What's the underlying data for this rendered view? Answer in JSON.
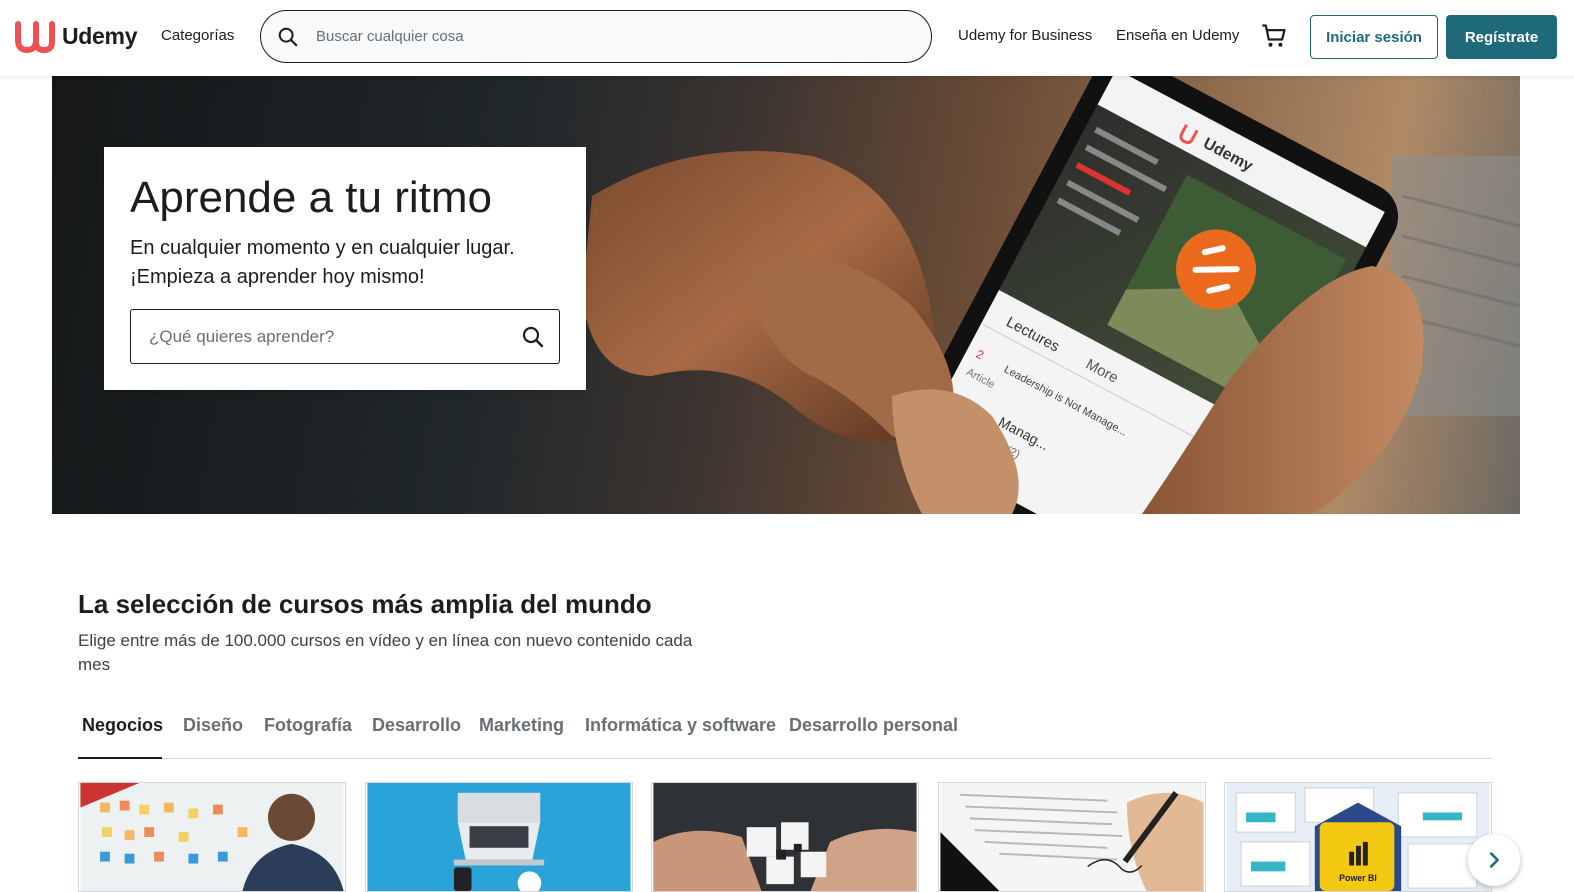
{
  "header": {
    "brand": "Udemy",
    "categories_label": "Categorías",
    "search_placeholder": "Buscar cualquier cosa",
    "business_link": "Udemy for Business",
    "teach_link": "Enseña en Udemy",
    "login_label": "Iniciar sesión",
    "signup_label": "Regístrate"
  },
  "hero": {
    "title": "Aprende a tu ritmo",
    "subtitle_line1": "En cualquier momento y en cualquier lugar.",
    "subtitle_line2": "¡Empieza a aprender hoy mismo!",
    "search_placeholder": "¿Qué quieres aprender?",
    "phone_brand": "Udemy",
    "phone_tab_lectures": "Lectures",
    "phone_tab_more": "More",
    "phone_item1": "Leadership is Not Manage...",
    "phone_item2": "Manag...",
    "phone_item_count": "(2)",
    "phone_article": "Article",
    "phone_number": "2"
  },
  "section": {
    "title": "La selección de cursos más amplia del mundo",
    "subtitle": "Elige entre más de 100.000 cursos en vídeo y en línea con nuevo contenido cada mes"
  },
  "tabs": [
    {
      "label": "Negocios",
      "active": true
    },
    {
      "label": "Diseño",
      "active": false
    },
    {
      "label": "Fotografía",
      "active": false
    },
    {
      "label": "Desarrollo",
      "active": false
    },
    {
      "label": "Marketing",
      "active": false
    },
    {
      "label": "Informática y software",
      "active": false
    },
    {
      "label": "Desarrollo personal",
      "active": false
    }
  ],
  "cards": [
    {
      "image": "whiteboard-sticky-notes-man"
    },
    {
      "image": "laptop-blue-illustration"
    },
    {
      "image": "puzzle-pieces-hands"
    },
    {
      "image": "document-signing-pen"
    },
    {
      "image": "power-bi-dashboard",
      "badge_text": "Power BI"
    }
  ],
  "colors": {
    "brand_red": "#a435f0",
    "logo_red": "#ec5252",
    "teal": "#1e6a79",
    "text": "#1c1d1f",
    "muted": "#6a6f73"
  },
  "icons": {
    "search": "search-icon",
    "cart": "cart-icon",
    "next": "chevron-right-icon"
  }
}
